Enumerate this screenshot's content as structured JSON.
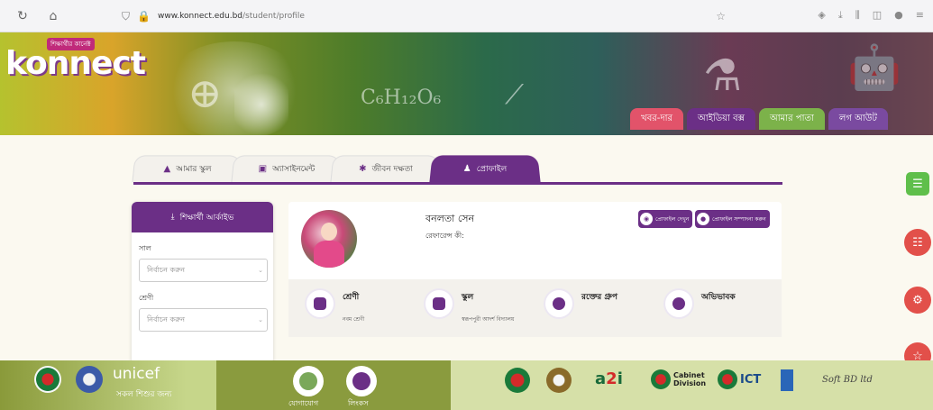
{
  "browser": {
    "url_host": "www.konnect.edu.bd",
    "url_path": "/student/profile"
  },
  "banner": {
    "logo_tag": "শিক্ষার্থীর কানেক্ট",
    "logo": "konnect",
    "nav_tabs": [
      "খবর-দার",
      "আইডিয়া বক্স",
      "আমার পাতা",
      "লগ আউট"
    ]
  },
  "tabs": [
    {
      "label": "আমার স্কুল",
      "icon": "school-icon"
    },
    {
      "label": "অ্যাসাইনমেন্ট",
      "icon": "assignment-icon"
    },
    {
      "label": "জীবন দক্ষতা",
      "icon": "life-skill-icon"
    },
    {
      "label": "প্রোফাইল",
      "icon": "profile-icon",
      "active": true
    }
  ],
  "filter": {
    "title": "শিক্ষার্থী আর্কাইভ",
    "field1_label": "সাল",
    "field1_placeholder": "নির্বাচন করুন",
    "field2_label": "শ্রেণী",
    "field2_placeholder": "নির্বাচন করুন"
  },
  "profile": {
    "name": "বনলতা সেন",
    "reference": "রেফারেন্স কী:",
    "btn_view": "প্রোফাইল দেখুন",
    "btn_edit": "প্রোফাইল সম্পাদনা করুন",
    "info": [
      {
        "title": "শ্রেণী",
        "value": "নবম শ্রেণী"
      },
      {
        "title": "স্কুল",
        "value": "স্বরূপপুরী আদর্শ বিদ্যালয়"
      },
      {
        "title": "রক্তের গ্রুপ",
        "value": ""
      },
      {
        "title": "অভিভাবক",
        "value": ""
      }
    ]
  },
  "footer": {
    "unicef": "unicef",
    "unicef_sub": "সকল শিশুর জন্য",
    "link1": "যোগাযোগ",
    "link2": "লিংকস",
    "cabinet_1": "Cabinet",
    "cabinet_2": "Division",
    "ict": "ICT",
    "softbd": "Soft BD ltd"
  },
  "colors": {
    "primary": "#6b2f86",
    "news_tab": "#e2536a",
    "page_tab": "#7cb24a",
    "float_red": "#e2504a",
    "float_green": "#5fbf4b"
  }
}
